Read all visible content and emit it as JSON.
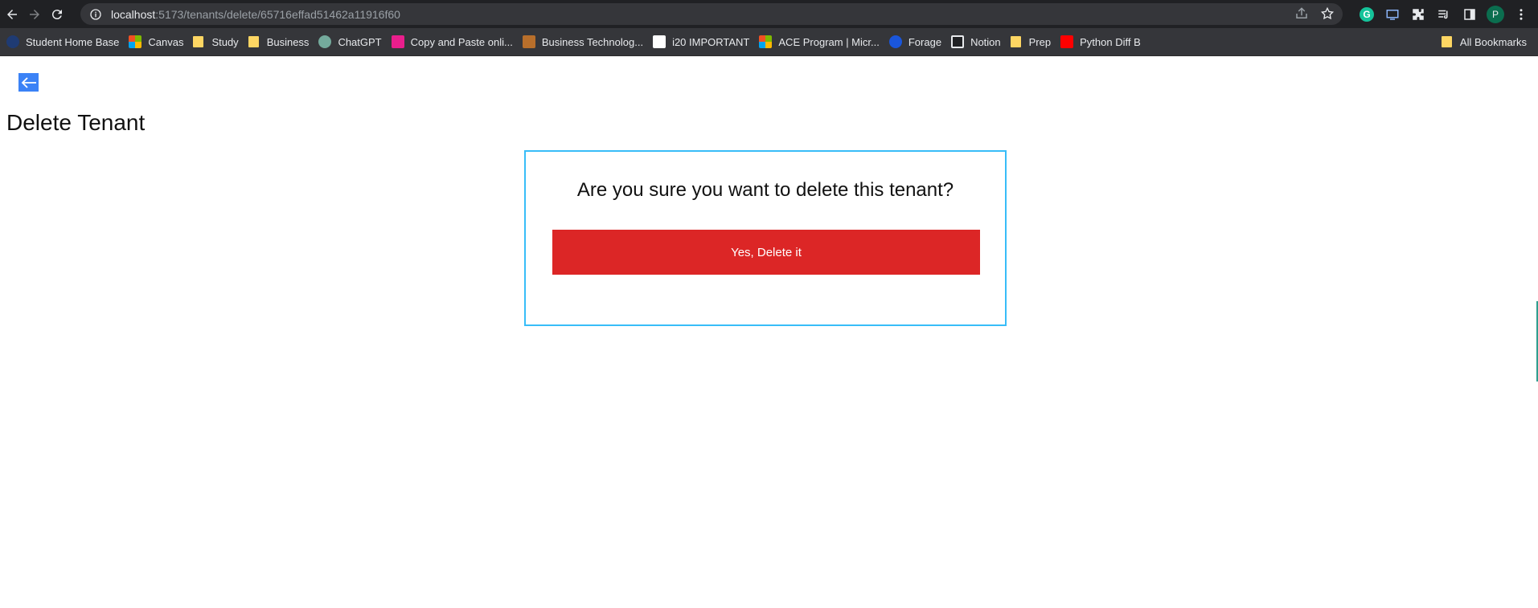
{
  "browser": {
    "url_host": "localhost",
    "url_path": ":5173/tenants/delete/65716effad51462a11916f60",
    "profile_initial": "P"
  },
  "bookmarks": [
    {
      "label": "Student Home Base",
      "icon": "school-icon",
      "color": "#1f3b73"
    },
    {
      "label": "Canvas",
      "icon": "microsoft-icon",
      "color": "#f25022"
    },
    {
      "label": "Study",
      "icon": "folder-icon",
      "color": "#fdd663"
    },
    {
      "label": "Business",
      "icon": "folder-icon",
      "color": "#fdd663"
    },
    {
      "label": "ChatGPT",
      "icon": "chatgpt-icon",
      "color": "#74aa9c"
    },
    {
      "label": "Copy and Paste onli...",
      "icon": "page-icon",
      "color": "#e91e8c"
    },
    {
      "label": "Business Technolog...",
      "icon": "diamond-icon",
      "color": "#b86f2b"
    },
    {
      "label": "i20 IMPORTANT",
      "icon": "blank-page-icon",
      "color": "#ffffff"
    },
    {
      "label": "ACE Program | Micr...",
      "icon": "microsoft-icon",
      "color": "#f25022"
    },
    {
      "label": "Forage",
      "icon": "forage-icon",
      "color": "#1a56db"
    },
    {
      "label": "Notion",
      "icon": "notion-icon",
      "color": "#ffffff"
    },
    {
      "label": "Prep",
      "icon": "folder-icon",
      "color": "#fdd663"
    },
    {
      "label": "Python Diff B",
      "icon": "youtube-icon",
      "color": "#ff0000"
    }
  ],
  "all_bookmarks_label": "All Bookmarks",
  "page": {
    "title": "Delete Tenant",
    "question": "Are you sure you want to delete this tenant?",
    "delete_label": "Yes, Delete it"
  },
  "colors": {
    "back_button": "#3b82f6",
    "delete_button": "#dc2626",
    "card_border": "#38bdf8"
  }
}
